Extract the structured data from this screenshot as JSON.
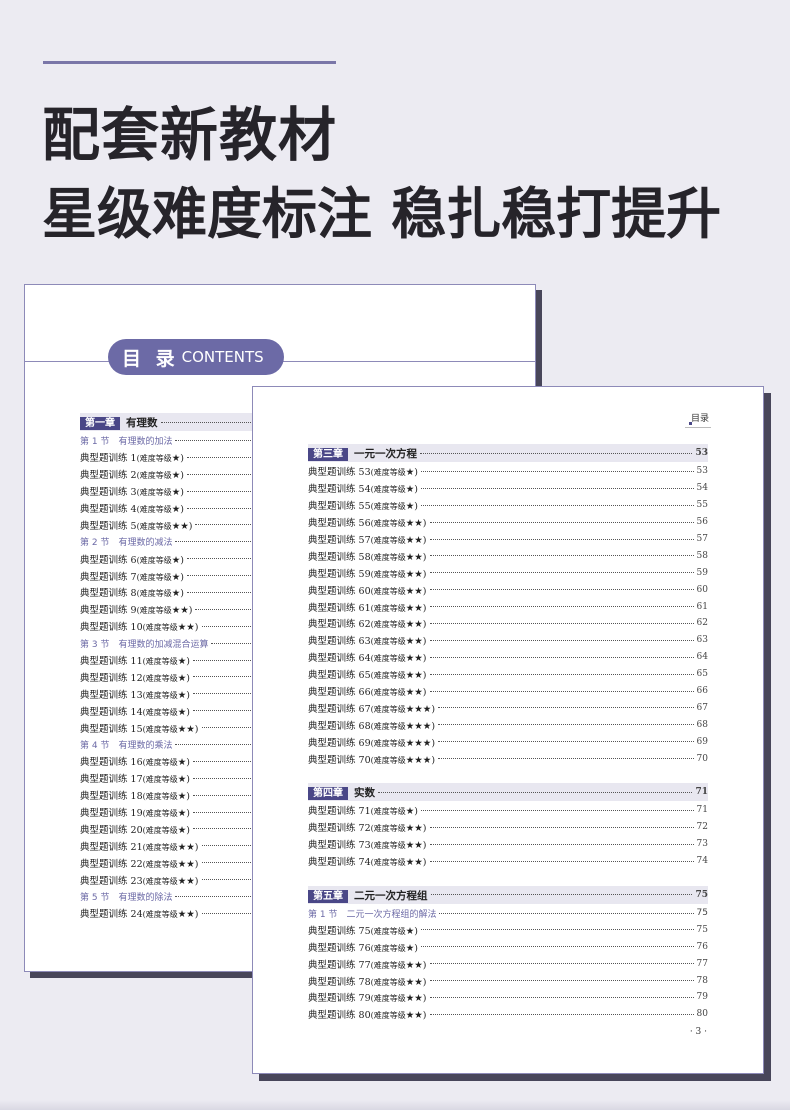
{
  "headline": {
    "line1": "配套新教材",
    "line2": "星级难度标注 稳扎稳打提升"
  },
  "back_page": {
    "header": {
      "cn": "目 录",
      "en": "CONTENTS"
    },
    "rows": [
      {
        "type": "ch",
        "tag": "第一章",
        "title": "有理数"
      },
      {
        "type": "sec",
        "text": "第 1 节　有理数的加法"
      },
      {
        "type": "item",
        "n": "1",
        "stars": "★"
      },
      {
        "type": "item",
        "n": "2",
        "stars": "★"
      },
      {
        "type": "item",
        "n": "3",
        "stars": "★"
      },
      {
        "type": "item",
        "n": "4",
        "stars": "★"
      },
      {
        "type": "item",
        "n": "5",
        "stars": "★★"
      },
      {
        "type": "sec",
        "text": "第 2 节　有理数的减法"
      },
      {
        "type": "item",
        "n": "6",
        "stars": "★"
      },
      {
        "type": "item",
        "n": "7",
        "stars": "★"
      },
      {
        "type": "item",
        "n": "8",
        "stars": "★"
      },
      {
        "type": "item",
        "n": "9",
        "stars": "★★"
      },
      {
        "type": "item",
        "n": "10",
        "stars": "★★"
      },
      {
        "type": "sec",
        "text": "第 3 节　有理数的加减混合运算"
      },
      {
        "type": "item",
        "n": "11",
        "stars": "★"
      },
      {
        "type": "item",
        "n": "12",
        "stars": "★"
      },
      {
        "type": "item",
        "n": "13",
        "stars": "★"
      },
      {
        "type": "item",
        "n": "14",
        "stars": "★"
      },
      {
        "type": "item",
        "n": "15",
        "stars": "★★"
      },
      {
        "type": "sec",
        "text": "第 4 节　有理数的乘法"
      },
      {
        "type": "item",
        "n": "16",
        "stars": "★"
      },
      {
        "type": "item",
        "n": "17",
        "stars": "★"
      },
      {
        "type": "item",
        "n": "18",
        "stars": "★"
      },
      {
        "type": "item",
        "n": "19",
        "stars": "★"
      },
      {
        "type": "item",
        "n": "20",
        "stars": "★"
      },
      {
        "type": "item",
        "n": "21",
        "stars": "★★"
      },
      {
        "type": "item",
        "n": "22",
        "stars": "★★"
      },
      {
        "type": "item",
        "n": "23",
        "stars": "★★"
      },
      {
        "type": "sec",
        "text": "第 5 节　有理数的除法"
      },
      {
        "type": "item",
        "n": "24",
        "stars": "★★"
      }
    ]
  },
  "front_page": {
    "header": "目录",
    "page_number": "· 3 ·",
    "rows": [
      {
        "type": "ch",
        "tag": "第三章",
        "title": "一元一次方程",
        "pg": "53"
      },
      {
        "type": "item",
        "n": "53",
        "stars": "★",
        "pg": "53"
      },
      {
        "type": "item",
        "n": "54",
        "stars": "★",
        "pg": "54"
      },
      {
        "type": "item",
        "n": "55",
        "stars": "★",
        "pg": "55"
      },
      {
        "type": "item",
        "n": "56",
        "stars": "★★",
        "pg": "56"
      },
      {
        "type": "item",
        "n": "57",
        "stars": "★★",
        "pg": "57"
      },
      {
        "type": "item",
        "n": "58",
        "stars": "★★",
        "pg": "58"
      },
      {
        "type": "item",
        "n": "59",
        "stars": "★★",
        "pg": "59"
      },
      {
        "type": "item",
        "n": "60",
        "stars": "★★",
        "pg": "60"
      },
      {
        "type": "item",
        "n": "61",
        "stars": "★★",
        "pg": "61"
      },
      {
        "type": "item",
        "n": "62",
        "stars": "★★",
        "pg": "62"
      },
      {
        "type": "item",
        "n": "63",
        "stars": "★★",
        "pg": "63"
      },
      {
        "type": "item",
        "n": "64",
        "stars": "★★",
        "pg": "64"
      },
      {
        "type": "item",
        "n": "65",
        "stars": "★★",
        "pg": "65"
      },
      {
        "type": "item",
        "n": "66",
        "stars": "★★",
        "pg": "66"
      },
      {
        "type": "item",
        "n": "67",
        "stars": "★★★",
        "pg": "67"
      },
      {
        "type": "item",
        "n": "68",
        "stars": "★★★",
        "pg": "68"
      },
      {
        "type": "item",
        "n": "69",
        "stars": "★★★",
        "pg": "69"
      },
      {
        "type": "item",
        "n": "70",
        "stars": "★★★",
        "pg": "70"
      },
      {
        "type": "gap"
      },
      {
        "type": "ch",
        "tag": "第四章",
        "title": "实数",
        "pg": "71"
      },
      {
        "type": "item",
        "n": "71",
        "stars": "★",
        "pg": "71"
      },
      {
        "type": "item",
        "n": "72",
        "stars": "★★",
        "pg": "72"
      },
      {
        "type": "item",
        "n": "73",
        "stars": "★★",
        "pg": "73"
      },
      {
        "type": "item",
        "n": "74",
        "stars": "★★",
        "pg": "74"
      },
      {
        "type": "gap"
      },
      {
        "type": "ch",
        "tag": "第五章",
        "title": "二元一次方程组",
        "pg": "75"
      },
      {
        "type": "sec",
        "text": "第 1 节　二元一次方程组的解法",
        "pg": "75"
      },
      {
        "type": "item",
        "n": "75",
        "stars": "★",
        "pg": "75"
      },
      {
        "type": "item",
        "n": "76",
        "stars": "★",
        "pg": "76"
      },
      {
        "type": "item",
        "n": "77",
        "stars": "★★",
        "pg": "77"
      },
      {
        "type": "item",
        "n": "78",
        "stars": "★★",
        "pg": "78"
      },
      {
        "type": "item",
        "n": "79",
        "stars": "★★",
        "pg": "79"
      },
      {
        "type": "item",
        "n": "80",
        "stars": "★★",
        "pg": "80"
      }
    ]
  }
}
